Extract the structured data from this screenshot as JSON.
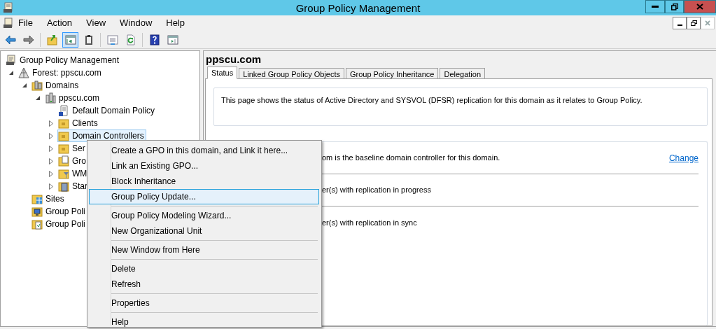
{
  "window": {
    "title": "Group Policy Management"
  },
  "menu_bar": [
    "File",
    "Action",
    "View",
    "Window",
    "Help"
  ],
  "toolbar": [
    {
      "kind": "back",
      "pressed": false
    },
    {
      "kind": "forward",
      "pressed": false
    },
    {
      "kind": "separator"
    },
    {
      "kind": "up",
      "pressed": false
    },
    {
      "kind": "tree",
      "pressed": true
    },
    {
      "kind": "clipboard",
      "pressed": false
    },
    {
      "kind": "separator"
    },
    {
      "kind": "export",
      "pressed": false
    },
    {
      "kind": "refresh",
      "pressed": false
    },
    {
      "kind": "separator"
    },
    {
      "kind": "help",
      "pressed": false
    },
    {
      "kind": "pane",
      "pressed": false
    }
  ],
  "tree": [
    {
      "label": "Group Policy Management",
      "selected": false,
      "children": [
        {
          "label": "Forest: ppscu.com",
          "expanded": true,
          "selected": false,
          "children": [
            {
              "label": "Domains",
              "expanded": true,
              "selected": false,
              "children": [
                {
                  "label": "ppscu.com",
                  "expanded": true,
                  "selected": false,
                  "children": [
                    {
                      "label": "Default Domain Policy",
                      "selected": false
                    },
                    {
                      "label": "Clients",
                      "expanded": false,
                      "selected": false
                    },
                    {
                      "label": "Domain Controllers",
                      "expanded": false,
                      "selected": true
                    },
                    {
                      "label": "Ser",
                      "expanded": false,
                      "selected": false
                    },
                    {
                      "label": "Gro",
                      "expanded": false,
                      "selected": false
                    },
                    {
                      "label": "WM",
                      "expanded": false,
                      "selected": false
                    },
                    {
                      "label": "Star",
                      "expanded": false,
                      "selected": false
                    }
                  ]
                }
              ]
            },
            {
              "label": "Sites",
              "selected": false
            },
            {
              "label": "Group Poli",
              "selected": false
            },
            {
              "label": "Group Poli",
              "selected": false
            }
          ]
        }
      ]
    }
  ],
  "details": {
    "heading": "ppscu.com",
    "tabs": [
      {
        "label": "Status",
        "selected": true
      },
      {
        "label": "Linked Group Policy Objects",
        "selected": false
      },
      {
        "label": "Group Policy Inheritance",
        "selected": false
      },
      {
        "label": "Delegation",
        "selected": false
      }
    ],
    "intro": "This page shows the status of Active Directory and SYSVOL (DFSR) replication for this domain as it relates to Group Policy.",
    "status_rows": [
      {
        "text": "om is the baseline domain controller for this domain.",
        "link": "Change"
      },
      {
        "text": "er(s) with replication in progress"
      },
      {
        "text": "er(s) with replication in sync"
      }
    ]
  },
  "context_menu": {
    "groups": [
      [
        {
          "label": "Create a GPO in this domain, and Link it here...",
          "selected": false
        },
        {
          "label": "Link an Existing GPO...",
          "selected": false
        },
        {
          "label": "Block Inheritance",
          "selected": false
        },
        {
          "label": "Group Policy Update...",
          "selected": true
        }
      ],
      [
        {
          "label": "Group Policy Modeling Wizard...",
          "selected": false
        },
        {
          "label": "New Organizational Unit",
          "selected": false
        }
      ],
      [
        {
          "label": "New Window from Here",
          "selected": false
        }
      ],
      [
        {
          "label": "Delete",
          "selected": false
        },
        {
          "label": "Refresh",
          "selected": false
        }
      ],
      [
        {
          "label": "Properties",
          "selected": false
        }
      ],
      [
        {
          "label": "Help",
          "selected": false
        }
      ]
    ]
  }
}
